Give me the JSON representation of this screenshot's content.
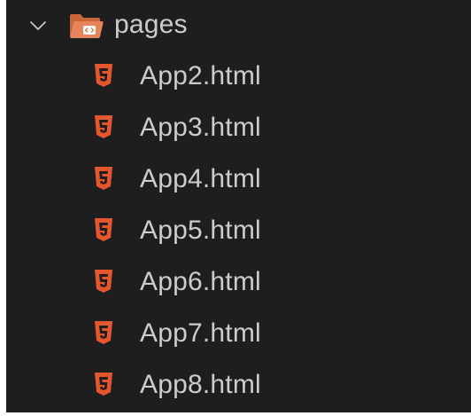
{
  "explorer": {
    "folder": {
      "name": "pages",
      "expanded": true,
      "icon": "folder-open-html-icon",
      "icon_color": "#e07a4b"
    },
    "files": [
      {
        "name": "App2.html",
        "icon": "html5-icon"
      },
      {
        "name": "App3.html",
        "icon": "html5-icon"
      },
      {
        "name": "App4.html",
        "icon": "html5-icon"
      },
      {
        "name": "App5.html",
        "icon": "html5-icon"
      },
      {
        "name": "App6.html",
        "icon": "html5-icon"
      },
      {
        "name": "App7.html",
        "icon": "html5-icon"
      },
      {
        "name": "App8.html",
        "icon": "html5-icon"
      }
    ],
    "colors": {
      "background": "#1e1e1e",
      "text": "#cccccc",
      "html_icon": "#e4572e"
    }
  }
}
